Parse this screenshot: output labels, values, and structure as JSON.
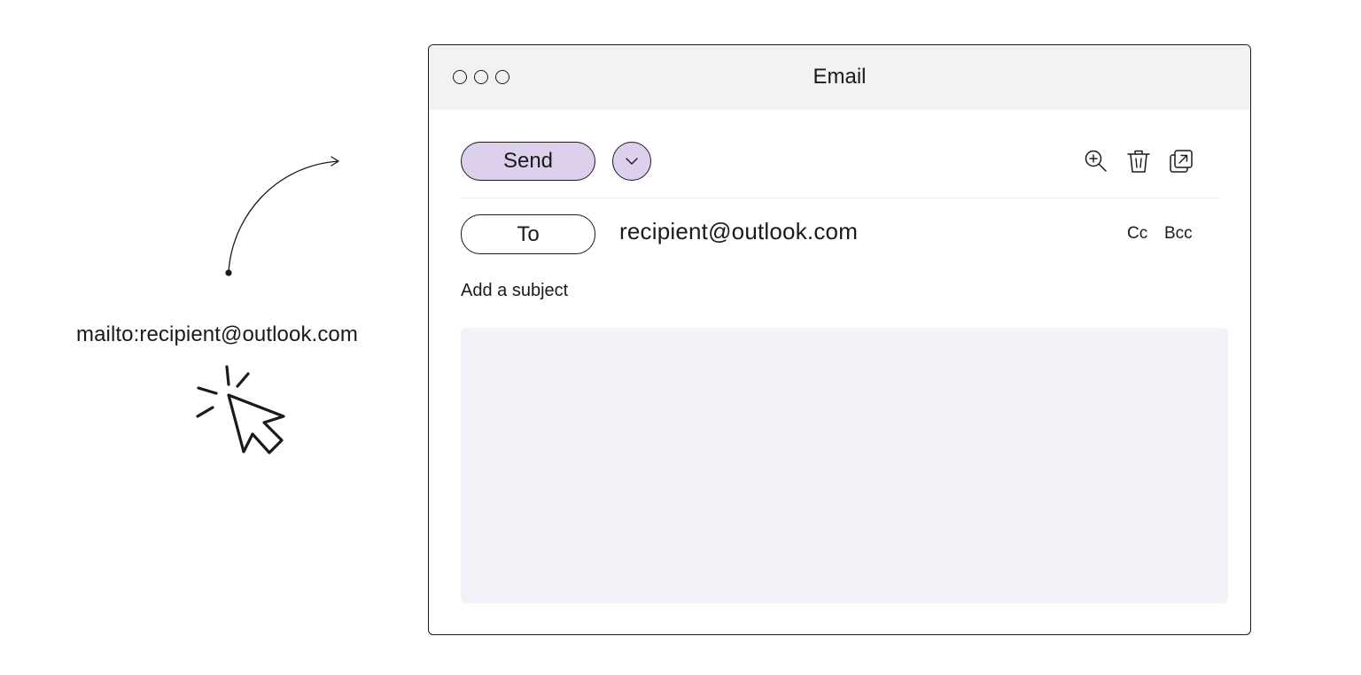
{
  "illustration": {
    "mailto_link_text": "mailto:recipient@outlook.com",
    "arrow_icon": "curved-arrow-icon",
    "cursor_icon": "click-cursor-icon"
  },
  "window": {
    "title": "Email",
    "traffic_lights": [
      "close",
      "minimize",
      "maximize"
    ]
  },
  "toolbar": {
    "send_label": "Send",
    "send_options_icon": "chevron-down-icon",
    "icons": [
      "zoom-in-icon",
      "trash-icon",
      "pop-out-icon"
    ]
  },
  "recipients": {
    "to_label": "To",
    "to_value": "recipient@outlook.com",
    "cc_label": "Cc",
    "bcc_label": "Bcc"
  },
  "subject": {
    "placeholder": "Add a subject",
    "value": ""
  },
  "body": {
    "value": ""
  },
  "colors": {
    "accent": "#ddd0ec",
    "body_background": "#f5f1f9",
    "titlebar_background": "#f2f2f2",
    "stroke": "#1a1a1a"
  }
}
